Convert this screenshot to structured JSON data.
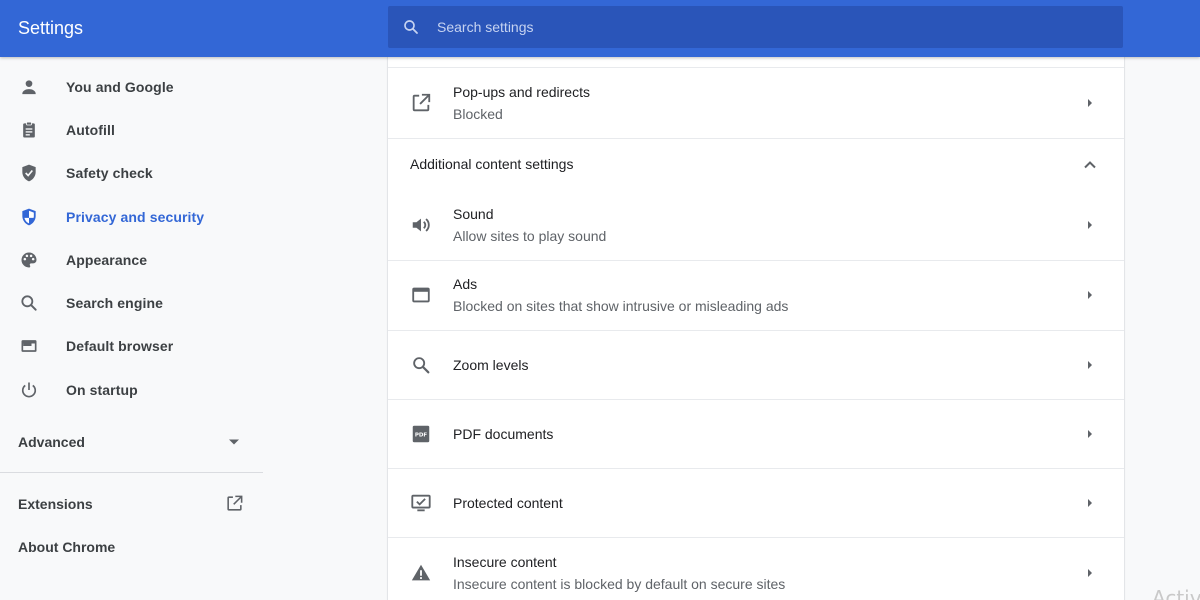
{
  "app": {
    "title": "Settings"
  },
  "search": {
    "placeholder": "Search settings",
    "value": ""
  },
  "sidebar": {
    "items": [
      {
        "label": "You and Google",
        "icon": "person-icon"
      },
      {
        "label": "Autofill",
        "icon": "clipboard-icon"
      },
      {
        "label": "Safety check",
        "icon": "shield-check-icon"
      },
      {
        "label": "Privacy and security",
        "icon": "shield-icon",
        "active": true
      },
      {
        "label": "Appearance",
        "icon": "palette-icon"
      },
      {
        "label": "Search engine",
        "icon": "search-icon"
      },
      {
        "label": "Default browser",
        "icon": "browser-window-icon"
      },
      {
        "label": "On startup",
        "icon": "power-icon"
      }
    ],
    "advanced_label": "Advanced",
    "extensions_label": "Extensions",
    "about_label": "About Chrome"
  },
  "content": {
    "popups": {
      "title": "Pop-ups and redirects",
      "subtitle": "Blocked"
    },
    "additional_section_title": "Additional content settings",
    "rows": [
      {
        "title": "Sound",
        "subtitle": "Allow sites to play sound",
        "icon": "speaker-icon"
      },
      {
        "title": "Ads",
        "subtitle": "Blocked on sites that show intrusive or misleading ads",
        "icon": "ads-window-icon"
      },
      {
        "title": "Zoom levels",
        "subtitle": "",
        "icon": "magnifier-icon"
      },
      {
        "title": "PDF documents",
        "subtitle": "",
        "icon": "pdf-icon"
      },
      {
        "title": "Protected content",
        "subtitle": "",
        "icon": "protected-monitor-icon"
      },
      {
        "title": "Insecure content",
        "subtitle": "Insecure content is blocked by default on secure sites",
        "icon": "warning-icon"
      }
    ]
  },
  "watermark": "Activ",
  "colors": {
    "header": "#3367d6",
    "search_bg": "#2a55b9",
    "accent": "#3367d6",
    "icon_gray": "#5f6368"
  }
}
